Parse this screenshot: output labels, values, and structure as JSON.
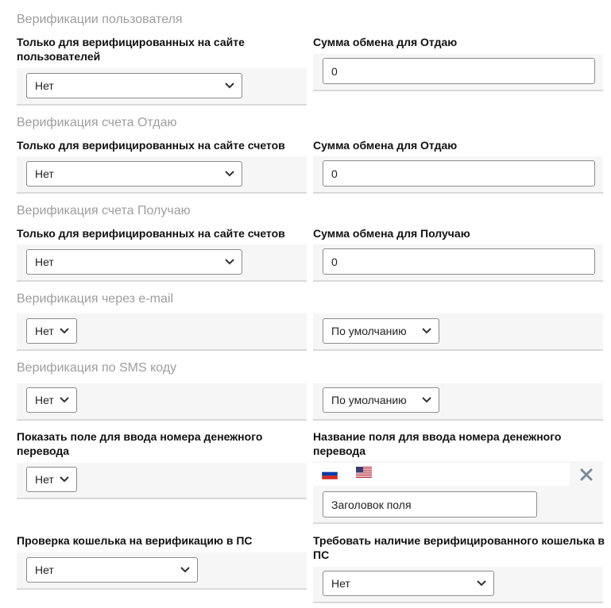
{
  "sections": {
    "user_verification": {
      "title": "Верификации пользователя",
      "left_label": "Только для верифицированных на сайте пользователей",
      "left_value": "Нет",
      "right_label": "Сумма обмена для Отдаю",
      "right_value": "0"
    },
    "account_give": {
      "title": "Верификация счета Отдаю",
      "left_label": "Только для верифицированных на сайте счетов",
      "left_value": "Нет",
      "right_label": "Сумма обмена для Отдаю",
      "right_value": "0"
    },
    "account_receive": {
      "title": "Верификация счета Получаю",
      "left_label": "Только для верифицированных на сайте счетов",
      "left_value": "Нет",
      "right_label": "Сумма обмена для Получаю",
      "right_value": "0"
    },
    "email": {
      "title": "Верификация через e-mail",
      "left_value": "Нет",
      "right_value": "По умолчанию"
    },
    "sms": {
      "title": "Верификация по SMS коду",
      "left_value": "Нет",
      "right_value": "По умолчанию"
    },
    "transfer_number": {
      "left_label": "Показать поле для ввода номера денежного перевода",
      "left_value": "Нет",
      "right_label": "Название поля для ввода номера денежного перевода",
      "right_placeholder": "Заголовок поля",
      "languages": [
        "ru-flag-icon",
        "us-flag-icon"
      ]
    },
    "wallet_check": {
      "left_label": "Проверка кошелька на верификацию в ПС",
      "left_value": "Нет",
      "right_label": "Требовать наличие верифицированного кошелька в ПС",
      "right_value": "Нет"
    }
  },
  "colors": {
    "section_title": "#9e9e9e",
    "strip_bg": "#f6f6f6",
    "strip_border": "#d9d9d9",
    "close_icon": "#7a8a99"
  }
}
